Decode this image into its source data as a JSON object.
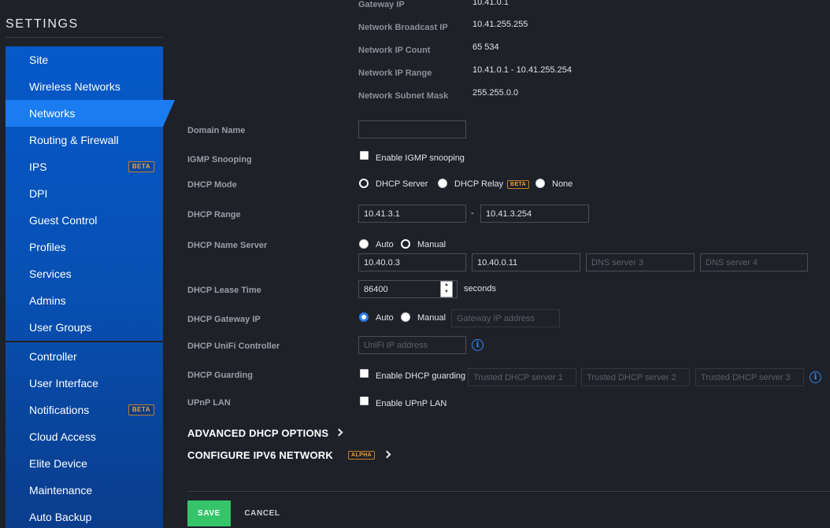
{
  "sidebar": {
    "title": "SETTINGS",
    "items": [
      {
        "label": "Site"
      },
      {
        "label": "Wireless Networks"
      },
      {
        "label": "Networks"
      },
      {
        "label": "Routing & Firewall"
      },
      {
        "label": "IPS",
        "badge": "BETA"
      },
      {
        "label": "DPI"
      },
      {
        "label": "Guest Control"
      },
      {
        "label": "Profiles"
      },
      {
        "label": "Services"
      },
      {
        "label": "Admins"
      },
      {
        "label": "User Groups"
      },
      {
        "label": "Controller"
      },
      {
        "label": "User Interface"
      },
      {
        "label": "Notifications",
        "badge": "BETA"
      },
      {
        "label": "Cloud Access"
      },
      {
        "label": "Elite Device"
      },
      {
        "label": "Maintenance"
      },
      {
        "label": "Auto Backup"
      }
    ]
  },
  "network_info": {
    "gateway_ip_label": "Gateway IP",
    "gateway_ip": "10.41.0.1",
    "broadcast_label": "Network Broadcast IP",
    "broadcast": "10.41.255.255",
    "count_label": "Network IP Count",
    "count": "65 534",
    "range_label": "Network IP Range",
    "range": "10.41.0.1 - 10.41.255.254",
    "mask_label": "Network Subnet Mask",
    "mask": "255.255.0.0"
  },
  "form": {
    "domain_name": {
      "label": "Domain Name",
      "value": ""
    },
    "igmp": {
      "label": "IGMP Snooping",
      "checkbox_label": "Enable IGMP snooping"
    },
    "dhcp_mode": {
      "label": "DHCP Mode",
      "server": "DHCP Server",
      "relay": "DHCP Relay",
      "relay_badge": "BETA",
      "none": "None"
    },
    "dhcp_range": {
      "label": "DHCP Range",
      "start": "10.41.3.1",
      "separator": "-",
      "end": "10.41.3.254"
    },
    "dhcp_name_server": {
      "label": "DHCP Name Server",
      "auto": "Auto",
      "manual": "Manual",
      "dns1": "10.40.0.3",
      "dns2": "10.40.0.11",
      "dns3_placeholder": "DNS server 3",
      "dns4_placeholder": "DNS server 4"
    },
    "dhcp_lease": {
      "label": "DHCP Lease Time",
      "value": "86400",
      "unit": "seconds"
    },
    "dhcp_gateway": {
      "label": "DHCP Gateway IP",
      "auto": "Auto",
      "manual": "Manual",
      "placeholder": "Gateway IP address"
    },
    "dhcp_unifi": {
      "label": "DHCP UniFi Controller",
      "placeholder": "UniFi IP address"
    },
    "dhcp_guarding": {
      "label": "DHCP Guarding",
      "checkbox_label": "Enable DHCP guarding",
      "p1": "Trusted DHCP server 1",
      "p2": "Trusted DHCP server 2",
      "p3": "Trusted DHCP server 3"
    },
    "upnp": {
      "label": "UPnP LAN",
      "checkbox_label": "Enable UPnP LAN"
    }
  },
  "sections": {
    "advanced_dhcp": "ADVANCED DHCP OPTIONS",
    "ipv6": "CONFIGURE IPV6 NETWORK",
    "ipv6_badge": "ALPHA"
  },
  "footer": {
    "save": "SAVE",
    "cancel": "CANCEL"
  },
  "colors": {
    "accent": "#1a7cf0",
    "save": "#35c46a",
    "badge": "#f0a23b"
  }
}
